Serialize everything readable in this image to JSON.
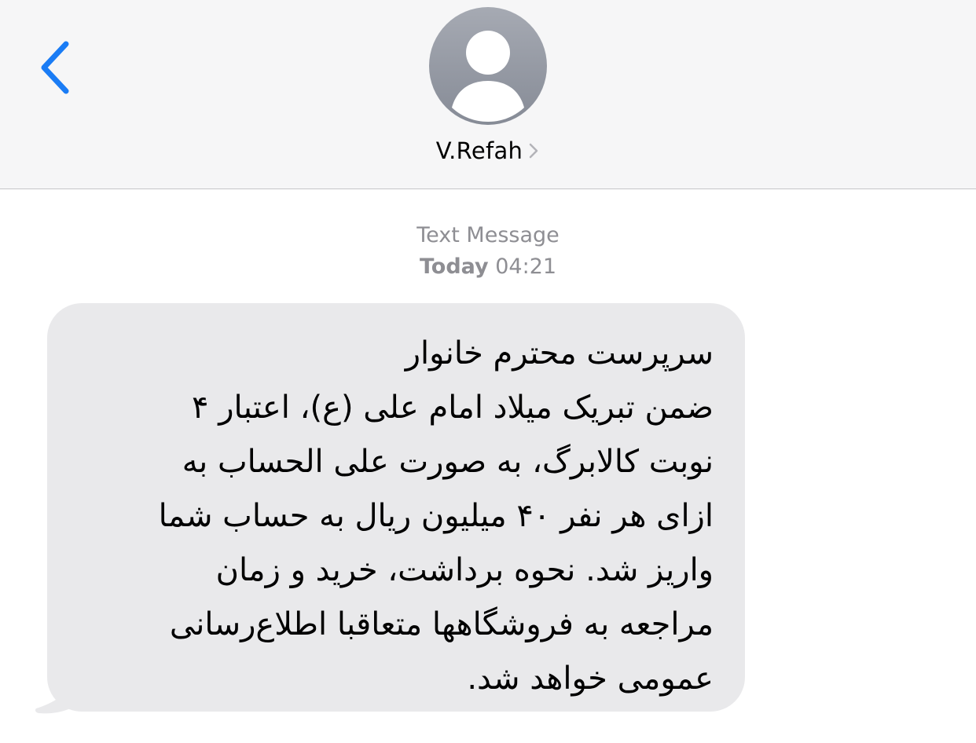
{
  "header": {
    "contact_name": "V.Refah",
    "back_icon": "chevron-left-icon",
    "avatar_icon": "person-icon",
    "disclosure_icon": "chevron-right-icon",
    "accent_color": "#1a7cf5"
  },
  "thread": {
    "service_label": "Text Message",
    "day_label": "Today",
    "time": "04:21"
  },
  "message": {
    "lines": [
      "سرپرست محترم خانوار",
      "ضمن تبریک میلاد امام علی (ع)، اعتبار ۴",
      "نوبت کالابرگ، به صورت علی الحساب به",
      "ازای هر نفر ۴۰ میلیون  ریال به حساب شما",
      "واریز شد. نحوه برداشت، خرید و زمان",
      "مراجعه به فروشگاهها متعاقبا اطلاع‌رسانی",
      "عمومی خواهد شد."
    ],
    "bubble_color": "#e9e9eb"
  }
}
